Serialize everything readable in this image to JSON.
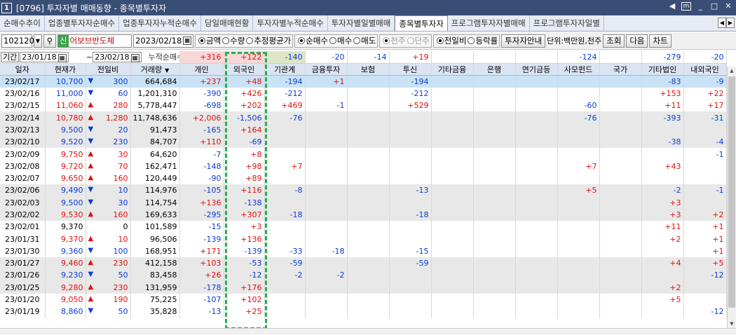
{
  "window": {
    "num": "1",
    "title": "[0796] 투자자별 매매동향 - 종목별투자자",
    "icons": [
      "left-arrow-icon",
      "menu-icon",
      "minimize-icon",
      "restore-icon",
      "close-icon"
    ]
  },
  "tabs": [
    "순매수추이",
    "업종별투자자순매수",
    "업종투자자누적순매수",
    "당일매매현황",
    "투자자별누적순매수",
    "투자자별일별매매",
    "종목별투자자",
    "프로그램투자자별매매",
    "프로그램투자자일별"
  ],
  "active_tab": 6,
  "toolbar": {
    "code": "102120",
    "credit_badge": "신",
    "stock_name": "어보브반도체",
    "date": "2023/02/18",
    "radio1": [
      "금액",
      "수량",
      "추정평균가"
    ],
    "radio2": [
      "순매수",
      "매수",
      "매도"
    ],
    "radio3": [
      "천주",
      "단주"
    ],
    "radio4": [
      "전일비",
      "등락률"
    ],
    "guide_btn": "투자자안내",
    "unit": "단위:백만원,천주",
    "search_btn": "조회",
    "next_btn": "다음",
    "chart_btn": "차트"
  },
  "period": {
    "label": "기간",
    "from": "23/01/18",
    "tilde": "~",
    "to": "23/02/18",
    "cum_label": "누적순매수"
  },
  "cumulative": [
    "+316",
    "+122",
    "-140",
    "-20",
    "-14",
    "+19",
    "",
    "",
    "",
    "-124",
    "",
    "-279",
    "-20"
  ],
  "headers": [
    "일자",
    "현재가",
    "전일비",
    "거래량",
    "개인",
    "외국인",
    "기관계",
    "금융투자",
    "보험",
    "투신",
    "기타금융",
    "은행",
    "연기금등",
    "사모펀드",
    "국가",
    "기타법인",
    "내외국인"
  ],
  "rows": [
    [
      "23/02/17",
      "10,700",
      "dn",
      "300",
      "664,684",
      "+237",
      "+48",
      "-194",
      "+1",
      "",
      "-194",
      "",
      "",
      "",
      "",
      "",
      "-83",
      "-9"
    ],
    [
      "23/02/16",
      "11,000",
      "dn",
      "60",
      "1,201,310",
      "-390",
      "+426",
      "-212",
      "",
      "",
      "-212",
      "",
      "",
      "",
      "",
      "",
      "+153",
      "+22"
    ],
    [
      "23/02/15",
      "11,060",
      "up",
      "280",
      "5,778,447",
      "-698",
      "+202",
      "+469",
      "-1",
      "",
      "+529",
      "",
      "",
      "",
      "-60",
      "",
      "+11",
      "+17"
    ],
    [
      "23/02/14",
      "10,780",
      "up",
      "1,280",
      "11,748,636",
      "+2,006",
      "-1,506",
      "-76",
      "",
      "",
      "",
      "",
      "",
      "",
      "-76",
      "",
      "-393",
      "-31"
    ],
    [
      "23/02/13",
      "9,500",
      "dn",
      "20",
      "91,473",
      "-165",
      "+164",
      "",
      "",
      "",
      "",
      "",
      "",
      "",
      "",
      "",
      "",
      ""
    ],
    [
      "23/02/10",
      "9,520",
      "dn",
      "230",
      "84,707",
      "+110",
      "-69",
      "",
      "",
      "",
      "",
      "",
      "",
      "",
      "",
      "",
      "-38",
      "-4"
    ],
    [
      "23/02/09",
      "9,750",
      "up",
      "30",
      "64,620",
      "-7",
      "+8",
      "",
      "",
      "",
      "",
      "",
      "",
      "",
      "",
      "",
      "",
      "-1"
    ],
    [
      "23/02/08",
      "9,720",
      "up",
      "70",
      "162,471",
      "-148",
      "+98",
      "+7",
      "",
      "",
      "",
      "",
      "",
      "",
      "+7",
      "",
      "+43",
      ""
    ],
    [
      "23/02/07",
      "9,650",
      "up",
      "160",
      "120,449",
      "-90",
      "+89",
      "",
      "",
      "",
      "",
      "",
      "",
      "",
      "",
      "",
      "",
      ""
    ],
    [
      "23/02/06",
      "9,490",
      "dn",
      "10",
      "114,976",
      "-105",
      "+116",
      "-8",
      "",
      "",
      "-13",
      "",
      "",
      "",
      "+5",
      "",
      "-2",
      "-1"
    ],
    [
      "23/02/03",
      "9,500",
      "dn",
      "30",
      "114,754",
      "+136",
      "-138",
      "",
      "",
      "",
      "",
      "",
      "",
      "",
      "",
      "",
      "+3",
      ""
    ],
    [
      "23/02/02",
      "9,530",
      "up",
      "160",
      "169,633",
      "-295",
      "+307",
      "-18",
      "",
      "",
      "-18",
      "",
      "",
      "",
      "",
      "",
      "+3",
      "+2"
    ],
    [
      "23/02/01",
      "9,370",
      "",
      "0",
      "101,589",
      "-15",
      "+3",
      "",
      "",
      "",
      "",
      "",
      "",
      "",
      "",
      "",
      "+11",
      "+1"
    ],
    [
      "23/01/31",
      "9,370",
      "up",
      "10",
      "96,506",
      "-139",
      "+136",
      "",
      "",
      "",
      "",
      "",
      "",
      "",
      "",
      "",
      "+2",
      "+1"
    ],
    [
      "23/01/30",
      "9,360",
      "dn",
      "100",
      "168,951",
      "+171",
      "-139",
      "-33",
      "-18",
      "",
      "-15",
      "",
      "",
      "",
      "",
      "",
      "",
      "+1"
    ],
    [
      "23/01/27",
      "9,460",
      "up",
      "230",
      "412,158",
      "+103",
      "-53",
      "-59",
      "",
      "",
      "-59",
      "",
      "",
      "",
      "",
      "",
      "+4",
      "+5"
    ],
    [
      "23/01/26",
      "9,230",
      "dn",
      "50",
      "83,458",
      "+26",
      "-12",
      "-2",
      "-2",
      "",
      "",
      "",
      "",
      "",
      "",
      "",
      "",
      "-12"
    ],
    [
      "23/01/25",
      "9,280",
      "up",
      "230",
      "131,959",
      "-178",
      "+176",
      "",
      "",
      "",
      "",
      "",
      "",
      "",
      "",
      "",
      "+2",
      ""
    ],
    [
      "23/01/20",
      "9,050",
      "up",
      "190",
      "75,225",
      "-107",
      "+102",
      "",
      "",
      "",
      "",
      "",
      "",
      "",
      "",
      "",
      "+5",
      ""
    ],
    [
      "23/01/19",
      "8,860",
      "dn",
      "50",
      "35,828",
      "-13",
      "+25",
      "",
      "",
      "",
      "",
      "",
      "",
      "",
      "",
      "",
      "",
      "-12"
    ]
  ]
}
